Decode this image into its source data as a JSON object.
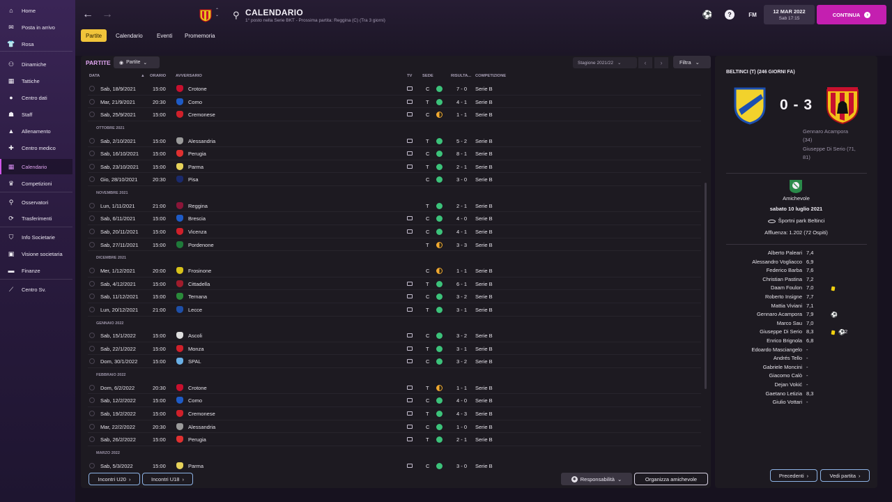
{
  "sidebar": {
    "items": [
      {
        "label": "Home",
        "icon": "home-icon",
        "glyph": "⌂"
      },
      {
        "label": "Posta in arrivo",
        "icon": "inbox-icon",
        "glyph": "✉"
      },
      {
        "label": "Rosa",
        "icon": "shirt-icon",
        "glyph": "👕"
      },
      {
        "label": "Dinamiche",
        "icon": "dynamics-icon",
        "glyph": "⚇"
      },
      {
        "label": "Tattiche",
        "icon": "tactics-icon",
        "glyph": "▦"
      },
      {
        "label": "Centro dati",
        "icon": "data-icon",
        "glyph": "●"
      },
      {
        "label": "Staff",
        "icon": "staff-icon",
        "glyph": "☗"
      },
      {
        "label": "Allenamento",
        "icon": "training-icon",
        "glyph": "▲"
      },
      {
        "label": "Centro medico",
        "icon": "medical-icon",
        "glyph": "✚"
      },
      {
        "label": "Calendario",
        "icon": "calendar-icon",
        "glyph": "▦"
      },
      {
        "label": "Competizioni",
        "icon": "trophy-icon",
        "glyph": "♛"
      },
      {
        "label": "Osservatori",
        "icon": "scout-icon",
        "glyph": "⚲"
      },
      {
        "label": "Trasferimenti",
        "icon": "transfer-icon",
        "glyph": "⟳"
      },
      {
        "label": "Info Societarie",
        "icon": "club-info-icon",
        "glyph": "⛉"
      },
      {
        "label": "Visione societaria",
        "icon": "vision-icon",
        "glyph": "▣"
      },
      {
        "label": "Finanze",
        "icon": "finance-icon",
        "glyph": "▬"
      },
      {
        "label": "Centro Sv.",
        "icon": "dev-centre-icon",
        "glyph": "⟋"
      }
    ]
  },
  "header": {
    "title": "CALENDARIO",
    "subtitle": "1° posto nella Serie BKT - Prossima partita: Reggina (C) (Tra 3 giorni)",
    "fm_label": "FM",
    "date": "12 MAR 2022",
    "time": "Sab 17:15",
    "continue_label": "CONTINUA",
    "tabs": [
      "Partite",
      "Calendario",
      "Eventi",
      "Promemoria"
    ]
  },
  "main": {
    "section_title": "PARTITE",
    "view_dropdown": "Partite",
    "season": "Stagione 2021/22",
    "filter_label": "Filtra",
    "columns": {
      "data": "DATA",
      "orario": "ORARIO",
      "avversario": "AVVERSARIO",
      "tv": "TV",
      "sede": "SEDE",
      "risultato": "RISULTA...",
      "competizione": "COMPETIZIONE"
    },
    "rows": [
      {
        "date": "Sab, 18/9/2021",
        "time": "15:00",
        "opp": "Crotone",
        "tv": true,
        "venue": "C",
        "res": "w",
        "score": "7 - 0",
        "comp": "Serie B",
        "color": "#c8102e"
      },
      {
        "date": "Mar, 21/9/2021",
        "time": "20:30",
        "opp": "Como",
        "tv": true,
        "venue": "T",
        "res": "w",
        "score": "4 - 1",
        "comp": "Serie B",
        "color": "#1e5bc6"
      },
      {
        "date": "Sab, 25/9/2021",
        "time": "15:00",
        "opp": "Cremonese",
        "tv": true,
        "venue": "C",
        "res": "d",
        "score": "1 - 1",
        "comp": "Serie B",
        "color": "#d0202a"
      },
      {
        "month": "OTTOBRE 2021"
      },
      {
        "date": "Sab, 2/10/2021",
        "time": "15:00",
        "opp": "Alessandria",
        "tv": true,
        "venue": "T",
        "res": "w",
        "score": "5 - 2",
        "comp": "Serie B",
        "color": "#9a9a9a"
      },
      {
        "date": "Sab, 16/10/2021",
        "time": "15:00",
        "opp": "Perugia",
        "tv": true,
        "venue": "C",
        "res": "w",
        "score": "8 - 1",
        "comp": "Serie B",
        "color": "#e03030"
      },
      {
        "date": "Sab, 23/10/2021",
        "time": "15:00",
        "opp": "Parma",
        "tv": true,
        "venue": "T",
        "res": "w",
        "score": "2 - 1",
        "comp": "Serie B",
        "color": "#e6d25a"
      },
      {
        "date": "Gio, 28/10/2021",
        "time": "20:30",
        "opp": "Pisa",
        "tv": false,
        "venue": "C",
        "res": "w",
        "score": "3 - 0",
        "comp": "Serie B",
        "color": "#1a2a6c"
      },
      {
        "month": "NOVEMBRE 2021"
      },
      {
        "date": "Lun, 1/11/2021",
        "time": "21:00",
        "opp": "Reggina",
        "tv": false,
        "venue": "T",
        "res": "w",
        "score": "2 - 1",
        "comp": "Serie B",
        "color": "#8a1538"
      },
      {
        "date": "Sab, 6/11/2021",
        "time": "15:00",
        "opp": "Brescia",
        "tv": true,
        "venue": "C",
        "res": "w",
        "score": "4 - 0",
        "comp": "Serie B",
        "color": "#1e5bc6"
      },
      {
        "date": "Sab, 20/11/2021",
        "time": "15:00",
        "opp": "Vicenza",
        "tv": true,
        "venue": "C",
        "res": "w",
        "score": "4 - 1",
        "comp": "Serie B",
        "color": "#d0202a"
      },
      {
        "date": "Sab, 27/11/2021",
        "time": "15:00",
        "opp": "Pordenone",
        "tv": false,
        "venue": "T",
        "res": "d",
        "score": "3 - 3",
        "comp": "Serie B",
        "color": "#1f7a3a"
      },
      {
        "month": "DICEMBRE 2021"
      },
      {
        "date": "Mer, 1/12/2021",
        "time": "20:00",
        "opp": "Frosinone",
        "tv": false,
        "venue": "C",
        "res": "d",
        "score": "1 - 1",
        "comp": "Serie B",
        "color": "#d8c21a"
      },
      {
        "date": "Sab, 4/12/2021",
        "time": "15:00",
        "opp": "Cittadella",
        "tv": true,
        "venue": "T",
        "res": "w",
        "score": "6 - 1",
        "comp": "Serie B",
        "color": "#a01c2c"
      },
      {
        "date": "Sab, 11/12/2021",
        "time": "15:00",
        "opp": "Ternana",
        "tv": true,
        "venue": "C",
        "res": "w",
        "score": "3 - 2",
        "comp": "Serie B",
        "color": "#2a8a3a"
      },
      {
        "date": "Lun, 20/12/2021",
        "time": "21:00",
        "opp": "Lecce",
        "tv": true,
        "venue": "T",
        "res": "w",
        "score": "3 - 1",
        "comp": "Serie B",
        "color": "#1e4fa8"
      },
      {
        "month": "GENNAIO 2022"
      },
      {
        "date": "Sab, 15/1/2022",
        "time": "15:00",
        "opp": "Ascoli",
        "tv": true,
        "venue": "C",
        "res": "w",
        "score": "3 - 2",
        "comp": "Serie B",
        "color": "#dddddd"
      },
      {
        "date": "Sab, 22/1/2022",
        "time": "15:00",
        "opp": "Monza",
        "tv": true,
        "venue": "T",
        "res": "w",
        "score": "3 - 1",
        "comp": "Serie B",
        "color": "#d0202a"
      },
      {
        "date": "Dom, 30/1/2022",
        "time": "15:00",
        "opp": "SPAL",
        "tv": true,
        "venue": "C",
        "res": "w",
        "score": "3 - 2",
        "comp": "Serie B",
        "color": "#6ab0e6"
      },
      {
        "month": "FEBBRAIO 2022"
      },
      {
        "date": "Dom, 6/2/2022",
        "time": "20:30",
        "opp": "Crotone",
        "tv": true,
        "venue": "T",
        "res": "d",
        "score": "1 - 1",
        "comp": "Serie B",
        "color": "#c8102e"
      },
      {
        "date": "Sab, 12/2/2022",
        "time": "15:00",
        "opp": "Como",
        "tv": true,
        "venue": "C",
        "res": "w",
        "score": "4 - 0",
        "comp": "Serie B",
        "color": "#1e5bc6"
      },
      {
        "date": "Sab, 19/2/2022",
        "time": "15:00",
        "opp": "Cremonese",
        "tv": true,
        "venue": "T",
        "res": "w",
        "score": "4 - 3",
        "comp": "Serie B",
        "color": "#d0202a"
      },
      {
        "date": "Mar, 22/2/2022",
        "time": "20:30",
        "opp": "Alessandria",
        "tv": true,
        "venue": "C",
        "res": "w",
        "score": "1 - 0",
        "comp": "Serie B",
        "color": "#9a9a9a"
      },
      {
        "date": "Sab, 26/2/2022",
        "time": "15:00",
        "opp": "Perugia",
        "tv": true,
        "venue": "T",
        "res": "w",
        "score": "2 - 1",
        "comp": "Serie B",
        "color": "#e03030"
      },
      {
        "month": "MARZO 2022"
      },
      {
        "date": "Sab, 5/3/2022",
        "time": "15:00",
        "opp": "Parma",
        "tv": true,
        "venue": "C",
        "res": "w",
        "score": "3 - 0",
        "comp": "Serie B",
        "color": "#e6d25a"
      }
    ],
    "result_colors": {
      "w": "#3cc27a",
      "d": "#f0a830"
    },
    "btn_u20": "Incontri U20",
    "btn_u18": "Incontri U18",
    "btn_resp": "Responsabilità",
    "btn_org": "Organizza amichevole"
  },
  "match": {
    "title": "BELTINCI (T) (246 GIORNI FA)",
    "score": "0 - 3",
    "scorers": [
      "Gennaro Acampora",
      "(34)",
      "Giuseppe Di Serio (71,",
      "81)"
    ],
    "competition": "Amichevole",
    "date": "sabato 10 luglio 2021",
    "stadium": "Športni park Beltinci",
    "attendance": "Affluenza: 1.202 (72 Ospiti)",
    "players": [
      {
        "name": "Alberto Paleari",
        "rating": "7,4"
      },
      {
        "name": "Alessandro Vogliacco",
        "rating": "6,9"
      },
      {
        "name": "Federico Barba",
        "rating": "7,6"
      },
      {
        "name": "Christian Pastina",
        "rating": "7,2"
      },
      {
        "name": "Daam Foulon",
        "rating": "7,0",
        "yellow": true
      },
      {
        "name": "Roberto Insigne",
        "rating": "7,7"
      },
      {
        "name": "Mattia Viviani",
        "rating": "7,1"
      },
      {
        "name": "Gennaro Acampora",
        "rating": "7,9",
        "goal": true
      },
      {
        "name": "Marco Sau",
        "rating": "7,0"
      },
      {
        "name": "Giuseppe Di Serio",
        "rating": "8,3",
        "yellow": true,
        "goal": true,
        "goal_count": "2"
      },
      {
        "name": "Enrico Brignola",
        "rating": "6,8"
      },
      {
        "name": "Edoardo Masciangelo",
        "rating": "-"
      },
      {
        "name": "Andrés Tello",
        "rating": "-"
      },
      {
        "name": "Gabriele Moncini",
        "rating": "-"
      },
      {
        "name": "Giacomo Calò",
        "rating": "-"
      },
      {
        "name": "Dejan Vokić",
        "rating": "-"
      },
      {
        "name": "Gaetano Letizia",
        "rating": "8,3"
      },
      {
        "name": "Giulio Vottari",
        "rating": "-"
      }
    ],
    "prev_label": "Precedenti",
    "next_label": "Vedi partita"
  }
}
